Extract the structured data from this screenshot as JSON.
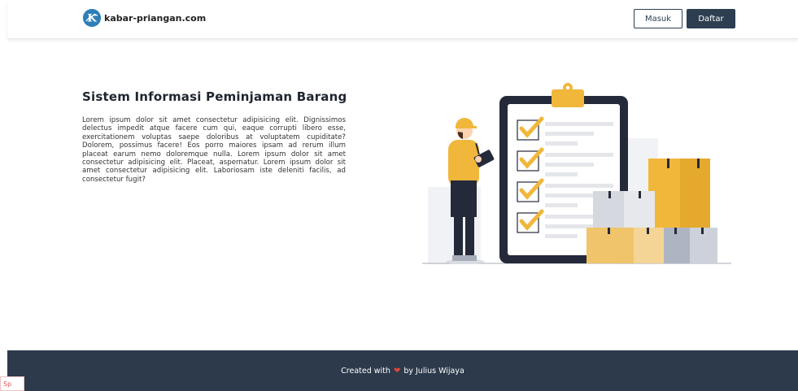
{
  "navbar": {
    "brand_name": "kabar-priangan.com",
    "login_label": "Masuk",
    "register_label": "Daftar"
  },
  "hero": {
    "title": "Sistem Informasi Peminjaman Barang",
    "description": "Lorem ipsum dolor sit amet consectetur adipisicing elit. Dignissimos delectus impedit atque facere cum qui, eaque corrupti libero esse, exercitationem voluptas saepe doloribus at voluptatem cupiditate? Dolorem, possimus facere! Eos porro maiores ipsam ad rerum illum placeat earum nemo doloremque nulla. Lorem ipsum dolor sit amet consectetur adipisicing elit. Placeat, aspernatur. Lorem ipsum dolor sit amet consectetur adipisicing elit. Laboriosam iste deleniti facilis, ad consectetur fugit?"
  },
  "footer": {
    "prefix": "Created with",
    "heart_icon": "heart-icon",
    "suffix": "by Julius Wijaya"
  },
  "corner_badge": "Sp",
  "colors": {
    "primary": "#2c3e50",
    "footer_bg": "#2c3a4b",
    "accent_yellow": "#f0b73a",
    "heart": "#e0443e"
  }
}
